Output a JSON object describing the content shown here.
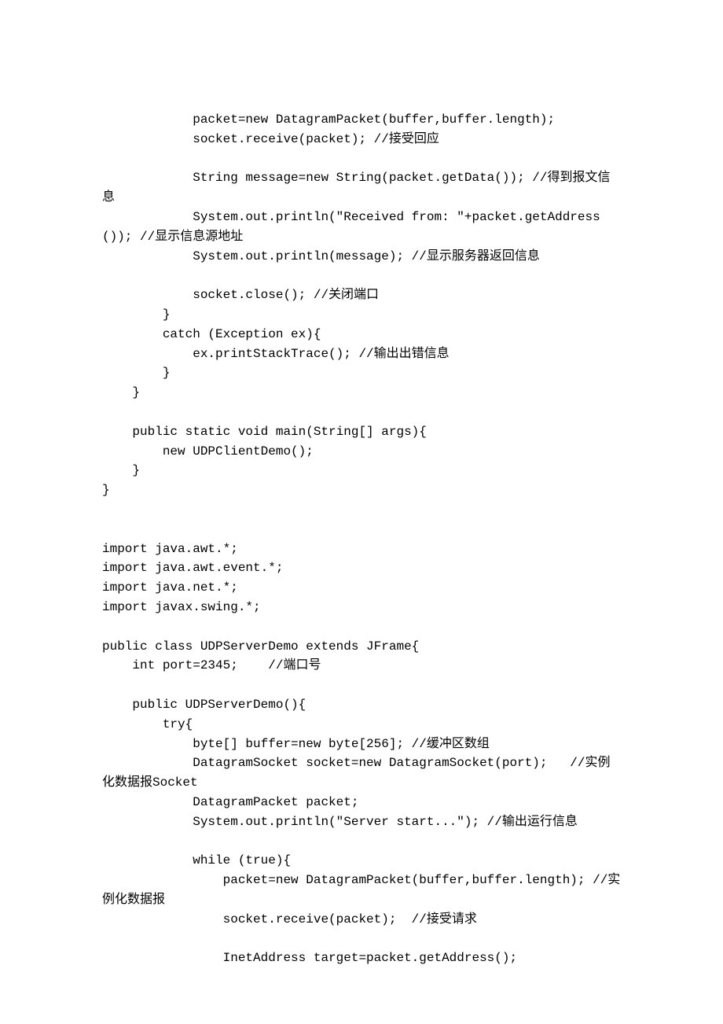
{
  "code": {
    "lines": [
      "            packet=new DatagramPacket(buffer,buffer.length);",
      "            socket.receive(packet); //接受回应",
      "",
      "            String message=new String(packet.getData()); //得到报文信息",
      "            System.out.println(\"Received from: \"+packet.getAddress()); //显示信息源地址",
      "            System.out.println(message); //显示服务器返回信息",
      "",
      "            socket.close(); //关闭端口",
      "        }",
      "        catch (Exception ex){",
      "            ex.printStackTrace(); //输出出错信息",
      "        }",
      "    }",
      "",
      "    public static void main(String[] args){",
      "        new UDPClientDemo();",
      "    }",
      "}",
      "",
      "",
      "import java.awt.*;",
      "import java.awt.event.*;",
      "import java.net.*;",
      "import javax.swing.*;",
      "",
      "public class UDPServerDemo extends JFrame{",
      "    int port=2345;    //端口号",
      "",
      "    public UDPServerDemo(){",
      "        try{",
      "            byte[] buffer=new byte[256]; //缓冲区数组",
      "            DatagramSocket socket=new DatagramSocket(port);   //实例化数据报Socket",
      "            DatagramPacket packet;",
      "            System.out.println(\"Server start...\"); //输出运行信息",
      "",
      "            while (true){",
      "                packet=new DatagramPacket(buffer,buffer.length); //实例化数据报",
      "                socket.receive(packet);  //接受请求",
      "",
      "                InetAddress target=packet.getAddress();"
    ]
  }
}
